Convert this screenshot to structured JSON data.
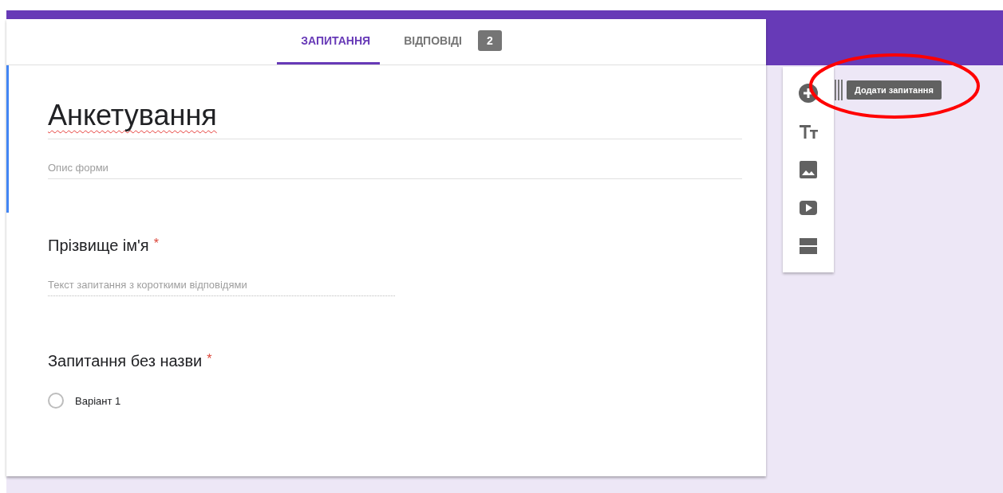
{
  "tabs": [
    {
      "label": "ЗАПИТАННЯ",
      "selected": true
    },
    {
      "label": "ВІДПОВІДІ",
      "selected": false,
      "badge": "2"
    }
  ],
  "form": {
    "title": "Анкетування",
    "description_placeholder": "Опис форми"
  },
  "questions": [
    {
      "kind": "short",
      "title": "Прізвище ім'я",
      "required": true,
      "required_mark": "*",
      "placeholder": "Текст запитання з короткими відповідями"
    },
    {
      "kind": "choice",
      "title": "Запитання без назви",
      "required": true,
      "required_mark": "*",
      "options": [
        {
          "label": "Варіант 1",
          "selected": false
        }
      ]
    }
  ],
  "toolbar": {
    "tooltip": "Додати запитання"
  }
}
